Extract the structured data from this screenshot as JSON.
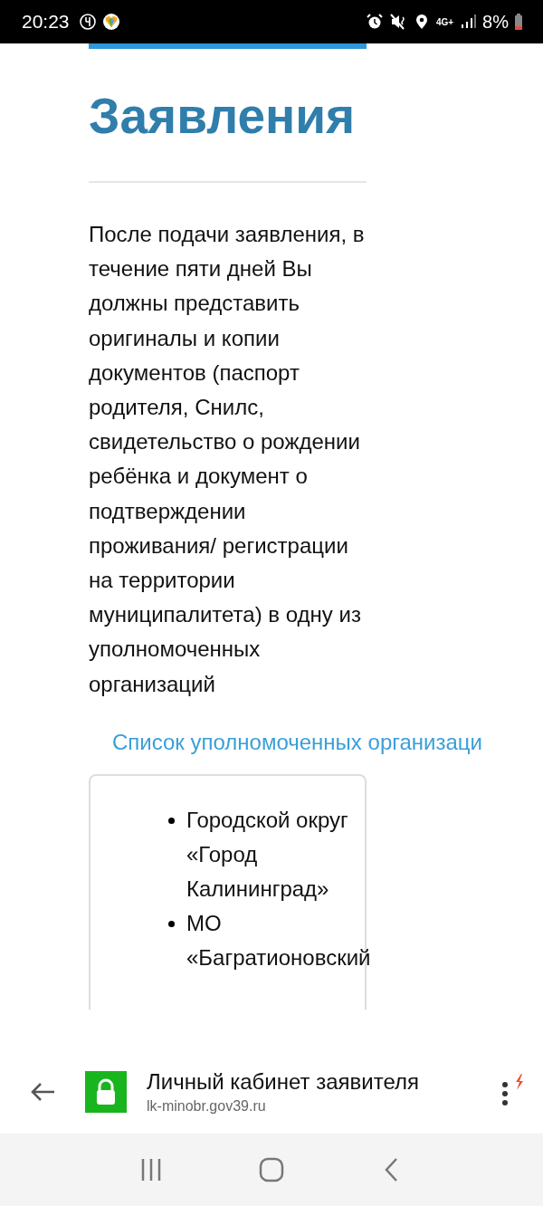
{
  "status_bar": {
    "time": "20:23",
    "network": "4G+",
    "battery": "8%"
  },
  "page": {
    "title": "Заявления",
    "paragraph": "После подачи заявления, в течение пяти дней Вы должны представить оригиналы и копии документов (паспорт родителя, Снилс, свидетельство о рождении ребёнка и документ о подтверждении проживания/ регистрации на территории муниципалитета) в одну из уполномоченных организаций",
    "link": "Список уполномоченных организаци",
    "organizations": [
      "Городской округ «Город Калининград»",
      "МО «Багратионовский"
    ]
  },
  "browser_bar": {
    "title": "Личный кабинет заявителя",
    "url": "lk-minobr.gov39.ru",
    "secure": true
  }
}
